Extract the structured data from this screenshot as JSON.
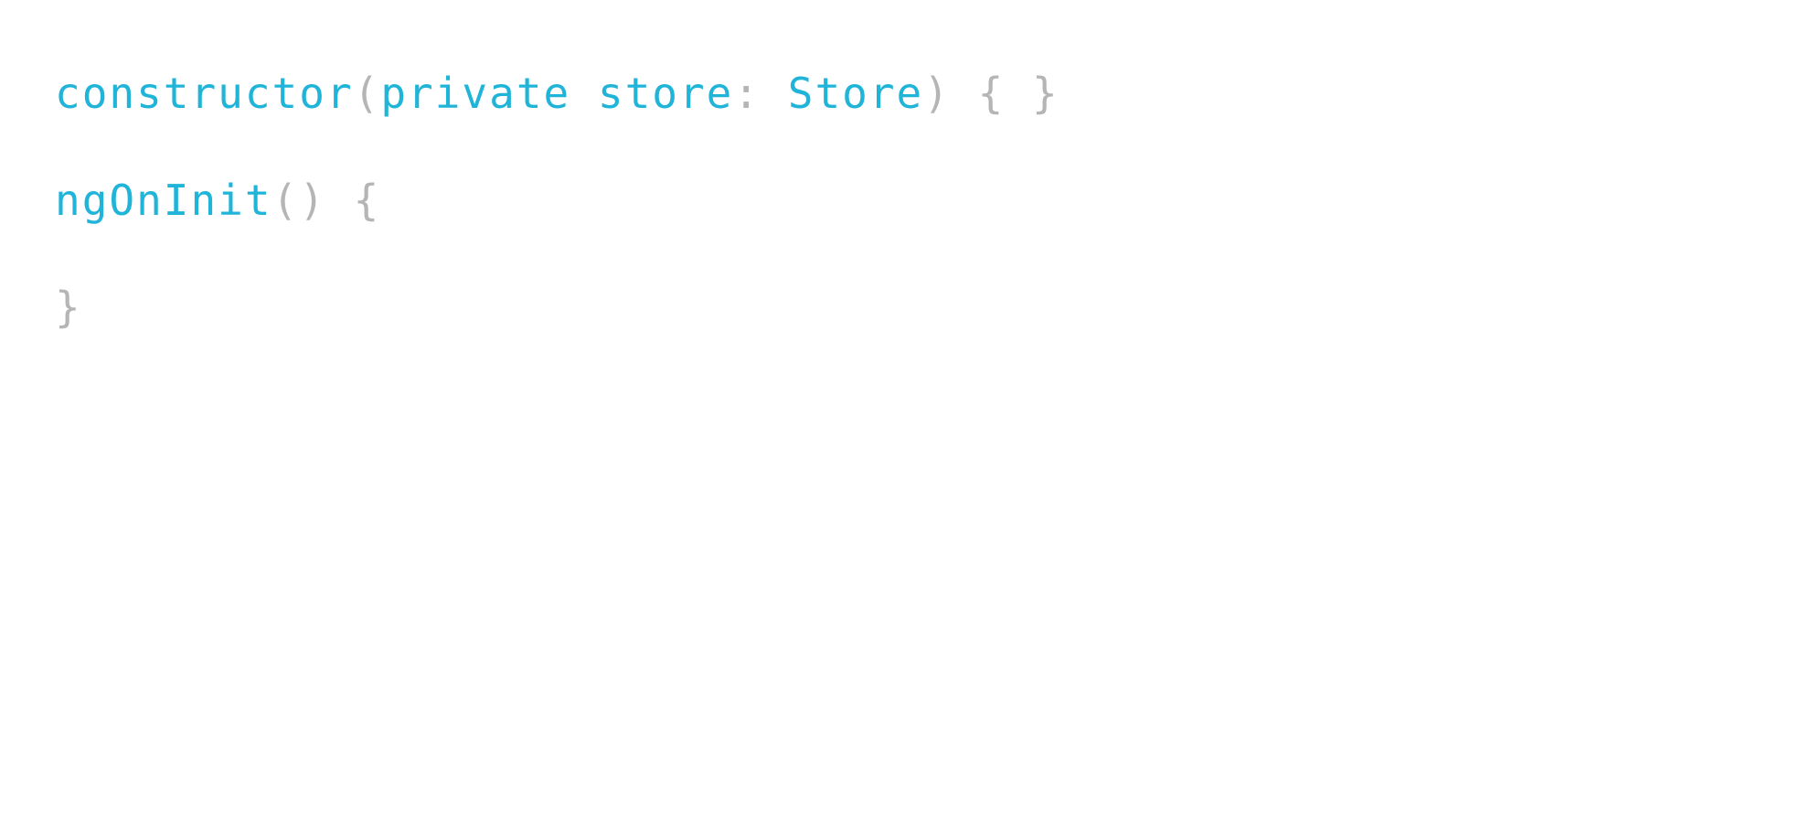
{
  "colors": {
    "identifier": "#1fb4d8",
    "punctuation": "#b5b5b5",
    "background": "#ffffff"
  },
  "code": {
    "lines": [
      {
        "tokens": [
          {
            "text": "constructor",
            "kind": "identifier"
          },
          {
            "text": "(",
            "kind": "punctuation"
          },
          {
            "text": "private store",
            "kind": "identifier"
          },
          {
            "text": ": ",
            "kind": "punctuation"
          },
          {
            "text": "Store",
            "kind": "identifier"
          },
          {
            "text": ") { }",
            "kind": "punctuation"
          }
        ]
      },
      {
        "tokens": [
          {
            "text": "ngOnInit",
            "kind": "identifier"
          },
          {
            "text": "() {",
            "kind": "punctuation"
          }
        ]
      },
      {
        "tokens": [
          {
            "text": "}",
            "kind": "punctuation"
          }
        ]
      }
    ]
  }
}
